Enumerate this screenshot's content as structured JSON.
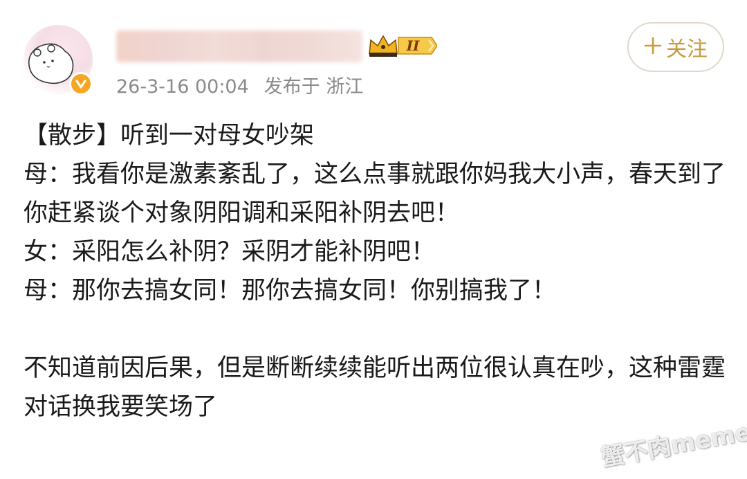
{
  "post": {
    "username_obscured": "",
    "vip_level": "II",
    "timestamp": "26-3-16 00:04",
    "published_at_label": "发布于 浙江",
    "follow_label": "关注",
    "follow_icon": "plus-icon",
    "lines": [
      "【散步】听到一对母女吵架",
      "母：我看你是激素紊乱了，这么点事就跟你妈我大小声，春天到了你赶紧谈个对象阴阳调和采阳补阴去吧！",
      "女：采阳怎么补阴？采阴才能补阴吧！",
      "母：那你去搞女同！那你去搞女同！你别搞我了！",
      "",
      "不知道前因后果，但是断断续续能听出两位很认真在吵，这种雷霆对话换我要笑场了"
    ]
  },
  "watermark": {
    "text": "蟹不肉meme"
  },
  "colors": {
    "follow_accent": "#c89a3c",
    "meta_gray": "#8a8a8a",
    "verify_orange": "#f6a623"
  }
}
